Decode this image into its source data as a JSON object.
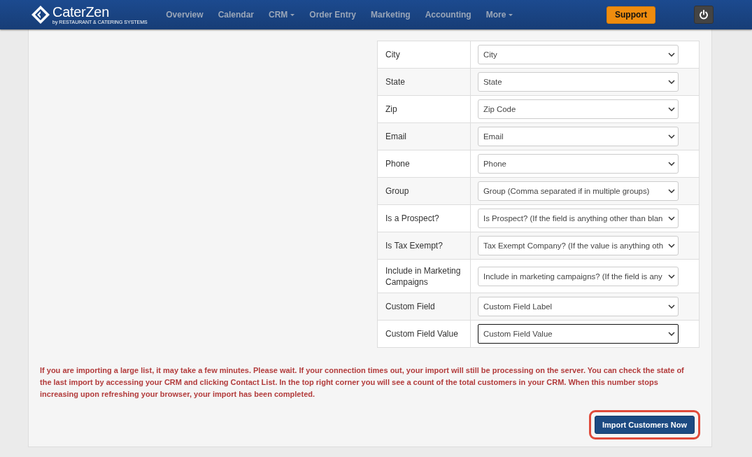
{
  "navbar": {
    "logo": {
      "name": "CaterZen",
      "tagline": "by RESTAURANT & CATERING SYSTEMS"
    },
    "items": [
      {
        "label": "Overview",
        "has_menu": false
      },
      {
        "label": "Calendar",
        "has_menu": false
      },
      {
        "label": "CRM",
        "has_menu": true
      },
      {
        "label": "Order Entry",
        "has_menu": false
      },
      {
        "label": "Marketing",
        "has_menu": false
      },
      {
        "label": "Accounting",
        "has_menu": false
      },
      {
        "label": "More",
        "has_menu": true
      }
    ],
    "support_button": "Support"
  },
  "mapping": [
    {
      "label": "City",
      "value": "City",
      "focused": false
    },
    {
      "label": "State",
      "value": "State",
      "focused": false
    },
    {
      "label": "Zip",
      "value": "Zip Code",
      "focused": false
    },
    {
      "label": "Email",
      "value": "Email",
      "focused": false
    },
    {
      "label": "Phone",
      "value": "Phone",
      "focused": false
    },
    {
      "label": "Group",
      "value": "Group (Comma separated if in multiple groups)",
      "focused": false
    },
    {
      "label": "Is a Prospect?",
      "value": "Is Prospect? (If the field is anything other than blan",
      "focused": false
    },
    {
      "label": "Is Tax Exempt?",
      "value": "Tax Exempt Company? (If the value is anything oth",
      "focused": false
    },
    {
      "label": "Include in Marketing Campaigns",
      "value": "Include in marketing campaigns? (If the field is any",
      "focused": false
    },
    {
      "label": "Custom Field",
      "value": "Custom Field Label",
      "focused": false
    },
    {
      "label": "Custom Field Value",
      "value": "Custom Field Value",
      "focused": true
    }
  ],
  "notice": "If you are importing a large list, it may take a few minutes. Please wait. If your connection times out, your import will still be processing on the server. You can check the state of the last import by accessing your CRM and clicking Contact List. In the top right corner you will see a count of the total customers in your CRM. When this number stops increasing upon refreshing your browser, your import has been completed.",
  "import_button": {
    "label": "Import Customers Now",
    "highlighted": true
  }
}
